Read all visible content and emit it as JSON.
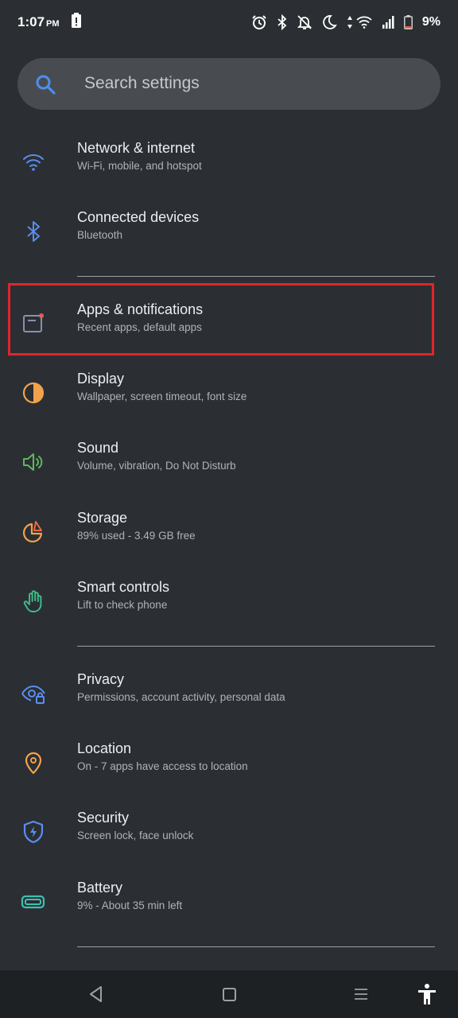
{
  "status_bar": {
    "time": "1:07",
    "ampm": "PM",
    "battery_percent": "9%",
    "icons": [
      "battery-alert-icon",
      "alarm-icon",
      "bluetooth-icon",
      "notifications-off-icon",
      "do-not-disturb-moon-icon",
      "data-arrows-icon",
      "wifi-icon",
      "signal-icon",
      "battery-icon"
    ]
  },
  "search": {
    "placeholder": "Search settings",
    "icon": "search-icon",
    "accent": "#4f8df0"
  },
  "settings": [
    {
      "title": "Network & internet",
      "subtitle": "Wi-Fi, mobile, and hotspot",
      "icon": "wifi-icon",
      "color": "#5b8def"
    },
    {
      "title": "Connected devices",
      "subtitle": "Bluetooth",
      "icon": "bluetooth-icon",
      "color": "#5b8def"
    },
    {
      "title": "Apps & notifications",
      "subtitle": "Recent apps, default apps",
      "icon": "apps-icon",
      "color": "#8a8fb0",
      "highlighted": true
    },
    {
      "title": "Display",
      "subtitle": "Wallpaper, screen timeout, font size",
      "icon": "display-brightness-icon",
      "color": "#f2a24a"
    },
    {
      "title": "Sound",
      "subtitle": "Volume, vibration, Do Not Disturb",
      "icon": "volume-icon",
      "color": "#5cb85c"
    },
    {
      "title": "Storage",
      "subtitle": "89% used - 3.49 GB free",
      "icon": "storage-pie-icon",
      "color": "#f2a24a"
    },
    {
      "title": "Smart controls",
      "subtitle": "Lift to check phone",
      "icon": "hand-icon",
      "color": "#3fbf8f"
    },
    {
      "title": "Privacy",
      "subtitle": "Permissions, account activity, personal data",
      "icon": "privacy-eye-icon",
      "color": "#5b8def"
    },
    {
      "title": "Location",
      "subtitle": "On - 7 apps have access to location",
      "icon": "location-pin-icon",
      "color": "#f2a24a"
    },
    {
      "title": "Security",
      "subtitle": "Screen lock, face unlock",
      "icon": "security-shield-icon",
      "color": "#5b8def"
    },
    {
      "title": "Battery",
      "subtitle": "9% - About 35 min left",
      "icon": "battery-icon",
      "color": "#3fbfb0"
    }
  ],
  "nav_bar": {
    "buttons": [
      "back-icon",
      "home-icon",
      "menu-icon",
      "accessibility-icon"
    ]
  },
  "highlight_color": "#e1252b"
}
